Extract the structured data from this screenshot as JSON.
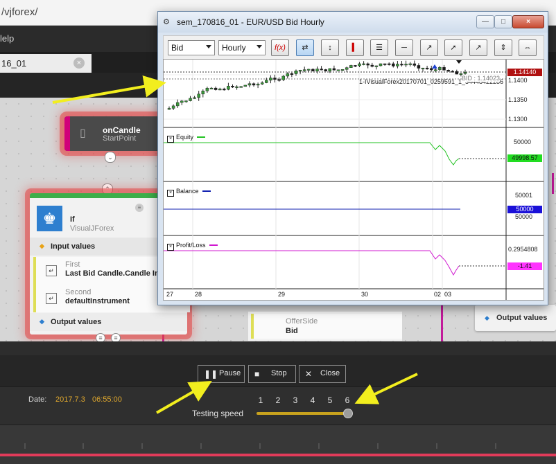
{
  "browser": {
    "url_fragment": "/vjforex/"
  },
  "menubar": {
    "help_fragment": "lelp"
  },
  "doc_tab": {
    "label": "16_01",
    "close": "×"
  },
  "nodes": {
    "on_candle": {
      "title": "onCandle",
      "subtitle": "StartPoint"
    },
    "if_node": {
      "title": "If",
      "subtitle": "VisualJForex",
      "input_values": "Input values",
      "first": {
        "label": "First",
        "value": "Last Bid Candle.Candle Ins"
      },
      "second": {
        "label": "Second",
        "value": "defaultInstrument"
      },
      "output_values": "Output values"
    },
    "offer_side": {
      "label": "OfferSide",
      "value": "Bid"
    },
    "right_output": {
      "label": "Output values"
    }
  },
  "chart_window": {
    "title": "sem_170816_01 - EUR/USD Bid Hourly",
    "offer_select": "Bid",
    "period_select": "Hourly",
    "window_buttons": {
      "minimize": "—",
      "maximize": "□",
      "close": "×"
    },
    "price_pane": {
      "price_label": "1.14140",
      "ticks": [
        "1.1400",
        "1.1350",
        "1.1300"
      ],
      "annotation": "1-IVisualForex20170701_0259591_1_34448422286",
      "bid_label": "BID : 1.14023"
    },
    "equity_pane": {
      "name": "Equity",
      "tick": "50000",
      "value_label": "49998.57",
      "color": "#22c322"
    },
    "balance_pane": {
      "name": "Balance",
      "ticks": [
        "50001",
        "50000"
      ],
      "value_label": "50000",
      "color": "#1020b0"
    },
    "pnl_pane": {
      "name": "Profit/Loss",
      "tick": "0.2954808",
      "value_label": "-1.41",
      "color": "#d018d0"
    },
    "dates": [
      "27",
      "28",
      "29",
      "30",
      "02",
      "03"
    ]
  },
  "tester": {
    "pause": "Pause",
    "stop": "Stop",
    "close": "Close",
    "date_label": "Date:",
    "date_value": "2017.7.3",
    "time_value": "06:55:00",
    "speeds": [
      "1",
      "2",
      "3",
      "4",
      "5",
      "6"
    ],
    "speed_label": "Testing speed",
    "speed_level": 6
  },
  "colors": {
    "accent_yellow": "#f2ee1e",
    "date_text": "#e0a82e",
    "candle_green": "#3a9a3a"
  }
}
